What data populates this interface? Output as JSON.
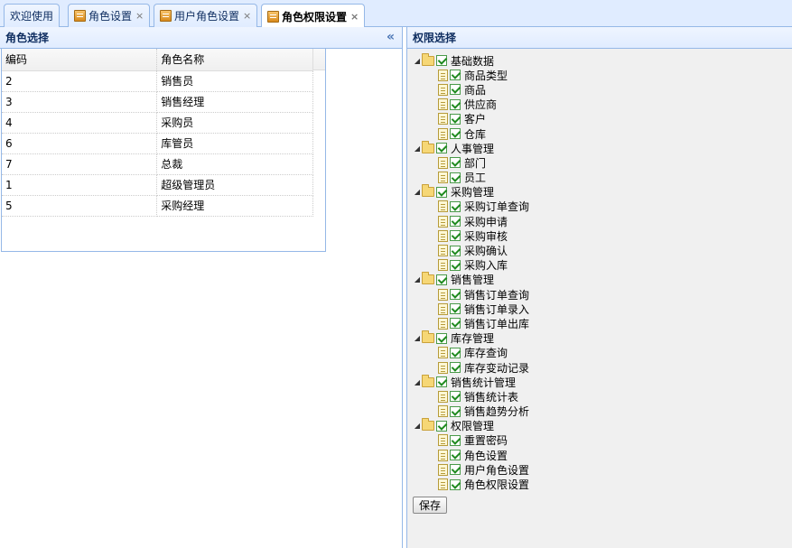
{
  "tabs": [
    {
      "label": "欢迎使用",
      "closable": false,
      "icon": "none"
    },
    {
      "label": "角色设置",
      "closable": true,
      "icon": "page-icon"
    },
    {
      "label": "用户角色设置",
      "closable": true,
      "icon": "page-icon"
    },
    {
      "label": "角色权限设置",
      "closable": true,
      "icon": "page-icon",
      "active": true
    }
  ],
  "close_glyph": "×",
  "left_panel": {
    "title": "角色选择",
    "collapse_glyph": "«",
    "columns": [
      "编码",
      "角色名称"
    ],
    "rows": [
      [
        "2",
        "销售员"
      ],
      [
        "3",
        "销售经理"
      ],
      [
        "4",
        "采购员"
      ],
      [
        "6",
        "库管员"
      ],
      [
        "7",
        "总裁"
      ],
      [
        "1",
        "超级管理员"
      ],
      [
        "5",
        "采购经理"
      ]
    ]
  },
  "right_panel": {
    "title": "权限选择",
    "tree": [
      {
        "label": "基础数据",
        "checked": true,
        "children": [
          "商品类型",
          "商品",
          "供应商",
          "客户",
          "仓库"
        ]
      },
      {
        "label": "人事管理",
        "checked": true,
        "children": [
          "部门",
          "员工"
        ]
      },
      {
        "label": "采购管理",
        "checked": true,
        "children": [
          "采购订单查询",
          "采购申请",
          "采购审核",
          "采购确认",
          "采购入库"
        ]
      },
      {
        "label": "销售管理",
        "checked": true,
        "children": [
          "销售订单查询",
          "销售订单录入",
          "销售订单出库"
        ]
      },
      {
        "label": "库存管理",
        "checked": true,
        "children": [
          "库存查询",
          "库存变动记录"
        ]
      },
      {
        "label": "销售统计管理",
        "checked": true,
        "children": [
          "销售统计表",
          "销售趋势分析"
        ]
      },
      {
        "label": "权限管理",
        "checked": true,
        "children": [
          "重置密码",
          "角色设置",
          "用户角色设置",
          "角色权限设置"
        ]
      }
    ],
    "save_label": "保存"
  },
  "colors": {
    "border": "#95b8e7",
    "header_bg": "#e0ecff",
    "title_text": "#0e2d5f",
    "check": "#1f8a1f"
  }
}
